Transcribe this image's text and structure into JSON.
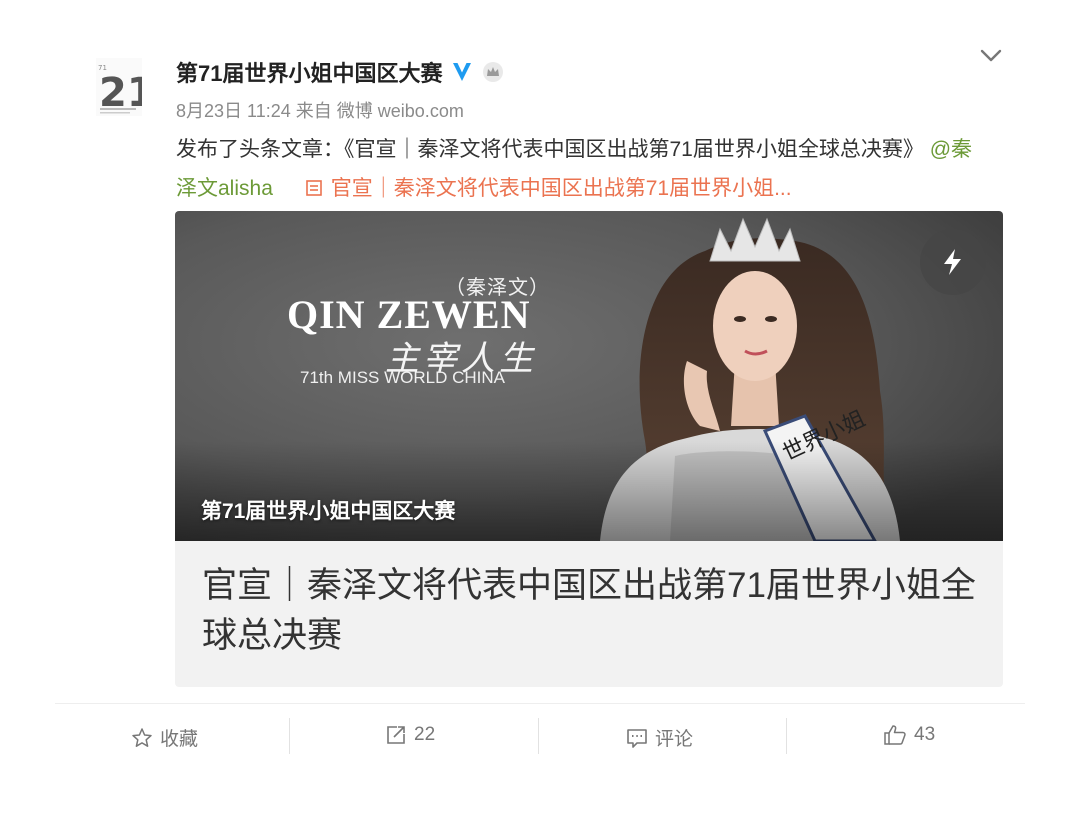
{
  "post": {
    "user_name": "第71届世界小姐中国区大赛",
    "date": "8月23日 11:24",
    "source_prefix": "来自",
    "source": "微博 weibo.com",
    "text_prefix": "发布了头条文章：《官宣｜秦泽文将代表中国区出战第71届世界小姐全球总决赛》",
    "mention": "@秦泽文alisha",
    "article_link": "官宣｜秦泽文将代表中国区出战第71届世界小姐...",
    "avatar_text": "21"
  },
  "card": {
    "cover_cn_small": "（秦泽文）",
    "cover_title": "QIN ZEWEN",
    "cover_cn_big": "主宰人生",
    "cover_sub": "71th MISS WORLD CHINA",
    "cover_caption": "第71届世界小姐中国区大赛",
    "sash_text": "世界小姐",
    "title": "官宣｜秦泽文将代表中国区出战第71届世界小姐全球总决赛"
  },
  "actions": {
    "favorite": "收藏",
    "repost": "22",
    "comment": "评论",
    "like": "43"
  },
  "colors": {
    "link_orange": "#eb7350",
    "mention_green": "#6c9a37",
    "verified_blue": "#1e9bf0"
  }
}
